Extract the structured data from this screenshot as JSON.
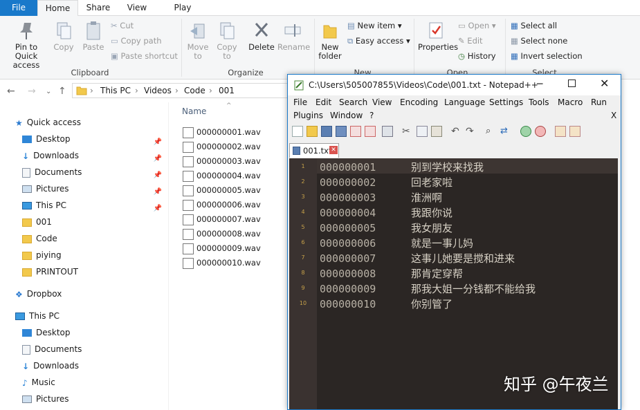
{
  "ribbon_tabs": [
    "File",
    "Home",
    "Share",
    "View",
    "Play"
  ],
  "ribbon": {
    "clipboard": {
      "label": "Clipboard",
      "pin": "Pin to Quick access",
      "copy": "Copy",
      "paste": "Paste",
      "cut": "Cut",
      "copy_path": "Copy path",
      "paste_shortcut": "Paste shortcut"
    },
    "organize": {
      "label": "Organize",
      "move_to": "Move to",
      "copy_to": "Copy to",
      "delete": "Delete",
      "rename": "Rename"
    },
    "new": {
      "label": "New",
      "new_folder": "New folder",
      "new_item": "New item",
      "easy_access": "Easy access"
    },
    "open": {
      "label": "Open",
      "properties": "Properties",
      "open": "Open",
      "edit": "Edit",
      "history": "History"
    },
    "select": {
      "label": "Select",
      "select_all": "Select all",
      "select_none": "Select none",
      "invert": "Invert selection"
    }
  },
  "breadcrumb": [
    "This PC",
    "Videos",
    "Code",
    "001"
  ],
  "nav": {
    "quick_access": "Quick access",
    "quick_items": [
      "Desktop",
      "Downloads",
      "Documents",
      "Pictures",
      "This PC",
      "001",
      "Code",
      "piying",
      "PRINTOUT"
    ],
    "dropbox": "Dropbox",
    "this_pc": "This PC",
    "pc_items": [
      "Desktop",
      "Documents",
      "Downloads",
      "Music",
      "Pictures"
    ]
  },
  "filelist": {
    "column": "Name",
    "files": [
      "000000001.wav",
      "000000002.wav",
      "000000003.wav",
      "000000004.wav",
      "000000005.wav",
      "000000006.wav",
      "000000007.wav",
      "000000008.wav",
      "000000009.wav",
      "000000010.wav"
    ]
  },
  "notepad": {
    "title": "C:\\Users\\505007855\\Videos\\Code\\001.txt - Notepad++",
    "menu1": [
      "File",
      "Edit",
      "Search",
      "View",
      "Encoding",
      "Language",
      "Settings",
      "Tools",
      "Macro",
      "Run"
    ],
    "menu2": [
      "Plugins",
      "Window",
      "?"
    ],
    "close_x": "X",
    "tab": "001.txt",
    "lines": [
      {
        "n": "1",
        "id": "000000001",
        "text": "别到学校来找我"
      },
      {
        "n": "2",
        "id": "000000002",
        "text": "回老家啦"
      },
      {
        "n": "3",
        "id": "000000003",
        "text": "淮洲啊"
      },
      {
        "n": "4",
        "id": "000000004",
        "text": "我跟你说"
      },
      {
        "n": "5",
        "id": "000000005",
        "text": "我女朋友"
      },
      {
        "n": "6",
        "id": "000000006",
        "text": "就是一事儿妈"
      },
      {
        "n": "7",
        "id": "000000007",
        "text": "这事儿她要是搅和进来"
      },
      {
        "n": "8",
        "id": "000000008",
        "text": "那肯定穿帮"
      },
      {
        "n": "9",
        "id": "000000009",
        "text": "那我大姐一分钱都不能给我"
      },
      {
        "n": "10",
        "id": "000000010",
        "text": "你别管了"
      }
    ]
  },
  "watermark": "知乎 @午夜兰"
}
